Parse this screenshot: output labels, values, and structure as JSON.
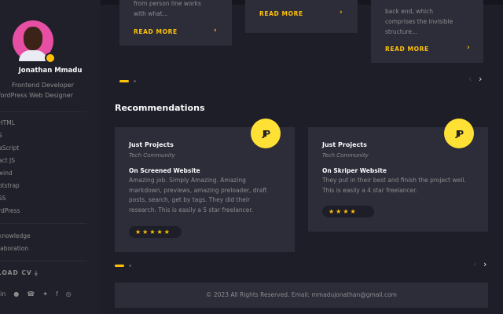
{
  "profile": {
    "name": "Jonathan Mmadu",
    "role_line1": "Frontend Developer",
    "role_line2": "WordPress Web Designer"
  },
  "skills": [
    "HTML",
    "S",
    "aScript",
    "act JS",
    "wind",
    "otstrap",
    "SS",
    "rdPress"
  ],
  "extras": [
    "knowledge",
    "laboration"
  ],
  "download_label": "LOAD CV",
  "download_icon": "download-icon",
  "socials": [
    "linkedin-icon",
    "github-icon",
    "whatsapp-icon",
    "twitter-icon",
    "facebook-icon",
    "instagram-icon"
  ],
  "top_cards": [
    {
      "text_lines": [
        "from person line works",
        "with what..."
      ],
      "read_more": "READ MORE"
    },
    {
      "text_lines": [],
      "read_more": "READ MORE"
    },
    {
      "text_lines": [
        "back end, which",
        "comprises the invisible",
        "structure..."
      ],
      "read_more": "READ MORE"
    }
  ],
  "recommendations_title": "Recommendations",
  "recommendations": [
    {
      "logo": "JP",
      "title": "Just Projects",
      "subtitle": "Tech Community",
      "heading": "On Screened Website",
      "body_lines": [
        "Amazing job. Simply Amazing. Amazing",
        "markdown, previews, amazing preloader, draft",
        "posts, search, get by tags. They did their",
        "research. This is easily a 5 star freelancer."
      ],
      "stars": "★★★★★"
    },
    {
      "logo": "JP",
      "title": "Just Projects",
      "subtitle": "Tech Community",
      "heading": "On Skriper Website",
      "body_lines": [
        "They put in their best and finish the project well.",
        "This is easily a 4 star freelancer."
      ],
      "stars": "★★★★"
    }
  ],
  "footer_text": "© 2023 All Rights Reserved. Email: mmadujonathan@gmail.com",
  "colors": {
    "accent": "#ffc107",
    "background": "#1e1e28",
    "card": "#2d2d3a",
    "sidebar": "#20202a"
  }
}
